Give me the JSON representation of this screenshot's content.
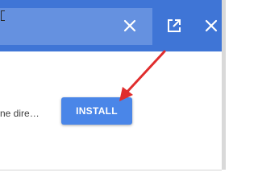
{
  "dialog": {
    "description_truncated": "ne dire…",
    "install_label": "INSTALL"
  },
  "toolbar": {
    "icons": [
      "close-icon",
      "open-in-new-icon",
      "close-icon"
    ]
  },
  "colors": {
    "titlebar": "#3f75d6",
    "omnibox": "#6591e0",
    "install_button": "#4a86e8",
    "annotation_arrow": "#e02d2d"
  }
}
